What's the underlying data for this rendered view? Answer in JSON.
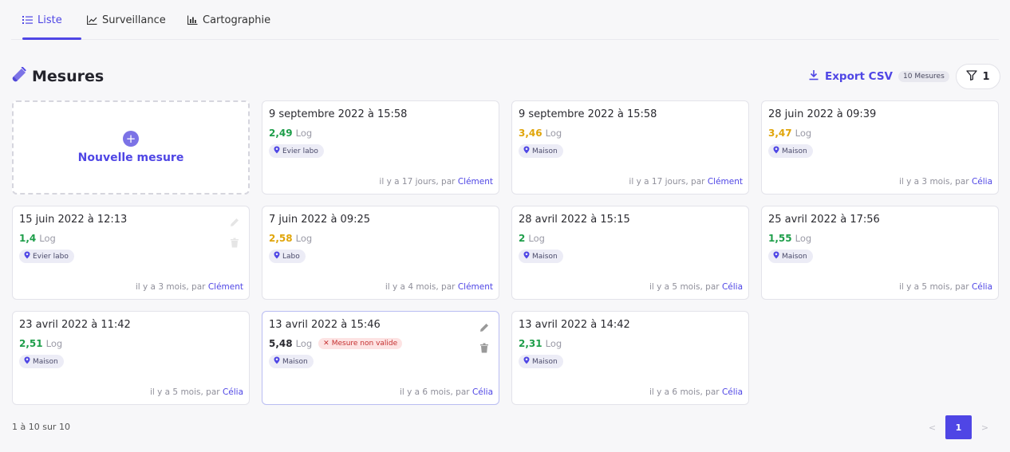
{
  "tabs": [
    {
      "label": "Liste",
      "icon": "list-icon",
      "active": true
    },
    {
      "label": "Surveillance",
      "icon": "line-chart-icon",
      "active": false
    },
    {
      "label": "Cartographie",
      "icon": "bar-chart-icon",
      "active": false
    }
  ],
  "page": {
    "title": "Mesures",
    "title_icon": "test-tube-icon"
  },
  "toolbar": {
    "export_label": "Export CSV",
    "export_count": "10 Mesures",
    "filter_count": "1"
  },
  "new_measure": {
    "label": "Nouvelle mesure",
    "plus": "+"
  },
  "measures": [
    {
      "date": "9 septembre 2022 à 15:58",
      "value": "2,49",
      "unit": "Log",
      "value_color": "#1e9e4a",
      "location": "Evier labo",
      "ago": "il y a 17 jours, par",
      "author": "Clément"
    },
    {
      "date": "9 septembre 2022 à 15:58",
      "value": "3,46",
      "unit": "Log",
      "value_color": "#e0a50a",
      "location": "Maison",
      "ago": "il y a 17 jours, par",
      "author": "Clément"
    },
    {
      "date": "28 juin 2022 à 09:39",
      "value": "3,47",
      "unit": "Log",
      "value_color": "#e0a50a",
      "location": "Maison",
      "ago": "il y a 3 mois, par",
      "author": "Célia"
    },
    {
      "date": "15 juin 2022 à 12:13",
      "value": "1,4",
      "unit": "Log",
      "value_color": "#1e9e4a",
      "location": "Evier labo",
      "ago": "il y a 3 mois, par",
      "author": "Clément"
    },
    {
      "date": "7 juin 2022 à 09:25",
      "value": "2,58",
      "unit": "Log",
      "value_color": "#e0a50a",
      "location": "Labo",
      "ago": "il y a 4 mois, par",
      "author": "Clément"
    },
    {
      "date": "28 avril 2022 à 15:15",
      "value": "2",
      "unit": "Log",
      "value_color": "#1e9e4a",
      "location": "Maison",
      "ago": "il y a 5 mois, par",
      "author": "Célia"
    },
    {
      "date": "25 avril 2022 à 17:56",
      "value": "1,55",
      "unit": "Log",
      "value_color": "#1e9e4a",
      "location": "Maison",
      "ago": "il y a 5 mois, par",
      "author": "Célia"
    },
    {
      "date": "23 avril 2022 à 11:42",
      "value": "2,51",
      "unit": "Log",
      "value_color": "#1e9e4a",
      "location": "Maison",
      "ago": "il y a 5 mois, par",
      "author": "Célia"
    },
    {
      "date": "13 avril 2022 à 15:46",
      "value": "5,48",
      "unit": "Log",
      "value_color": "#2a2a30",
      "location": "Maison",
      "ago": "il y a 6 mois, par",
      "author": "Célia",
      "invalid": "Mesure non valide"
    },
    {
      "date": "13 avril 2022 à 14:42",
      "value": "2,31",
      "unit": "Log",
      "value_color": "#1e9e4a",
      "location": "Maison",
      "ago": "il y a 6 mois, par",
      "author": "Célia"
    }
  ],
  "pagination": {
    "range": "1 à 10 sur 10",
    "prev": "<",
    "current": "1",
    "next": ">"
  }
}
